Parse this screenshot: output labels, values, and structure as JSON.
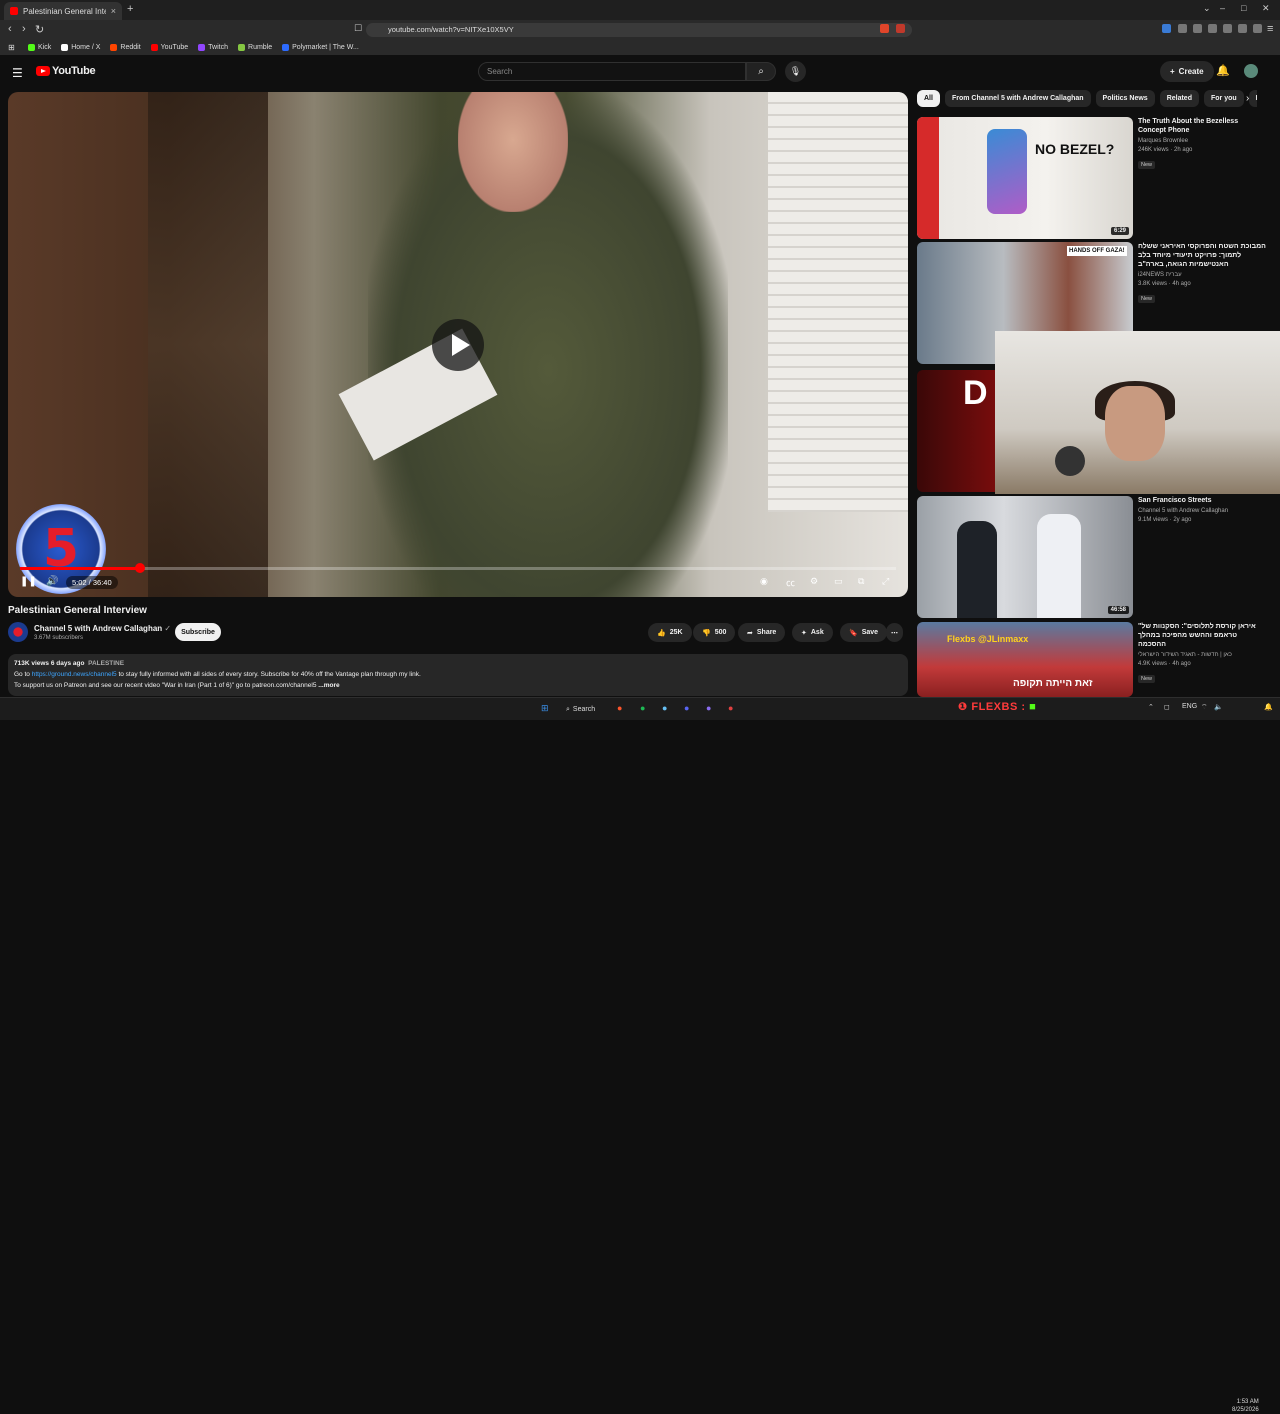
{
  "browser": {
    "tab_title": "Palestinian General Interview",
    "tab_close": "×",
    "new_tab": "+",
    "url": "youtube.com/watch?v=NITXe10X5VY",
    "bookmarks": [
      {
        "label": "Kick",
        "color": "#53fc18"
      },
      {
        "label": "Home / X",
        "color": "#ffffff"
      },
      {
        "label": "Reddit",
        "color": "#ff4500"
      },
      {
        "label": "YouTube",
        "color": "#ff0000"
      },
      {
        "label": "Twitch",
        "color": "#9146ff"
      },
      {
        "label": "Rumble",
        "color": "#85c742"
      },
      {
        "label": "Polymarket | The W...",
        "color": "#2d6bff"
      }
    ]
  },
  "youtube": {
    "logo_text": "YouTube",
    "search_placeholder": "Search",
    "create_label": "Create",
    "accent": "#ff0000"
  },
  "player": {
    "time": "5:02 / 36:40",
    "progress_fraction": 0.137,
    "logo_text": "5"
  },
  "video": {
    "title": "Palestinian General Interview",
    "channel": "Channel 5 with Andrew Callaghan",
    "subscribers": "3.67M subscribers",
    "subscribe_label": "Subscribe",
    "likes": "25K",
    "dislikes": "500",
    "share_label": "Share",
    "ask_label": "Ask",
    "save_label": "Save",
    "views_date": "713K views  6 days ago",
    "tag": "PALESTINE",
    "desc_prefix": "Go to ",
    "desc_link": "https://ground.news/channel5",
    "desc_suffix": " to stay fully informed with all sides of every story. Subscribe for 40% off the Vantage plan through my link.",
    "desc_line2": "To support us on Patreon and see our recent video \"War in Iran (Part 1 of 6)\" go to patreon.com/channel5",
    "more_label": "...more"
  },
  "chips": [
    "All",
    "From Channel 5 with Andrew Callaghan",
    "Politics News",
    "Related",
    "For you",
    "Rece"
  ],
  "recommendations": [
    {
      "title": "The Truth About the Bezelless Concept Phone",
      "channel": "Marques Brownlee",
      "stats": "246K views · 2h ago",
      "badge": "New",
      "duration": "6:29",
      "thumb_text": "NO BEZEL?"
    },
    {
      "title": "המבוכת השטח והפרוקסי האיראני ששלח לתמוך: פרויקט תיעודי מיוחד בלב האנטישמיות הגואה, בארה\"ב",
      "channel": "i24NEWS עברית",
      "stats": "3.8K views · 4h ago",
      "badge": "New",
      "duration": "",
      "thumb_text": "HANDS OFF GAZA!"
    },
    {
      "title": "",
      "channel": "",
      "stats": "",
      "badge": "",
      "duration": "",
      "thumb_text": "D"
    },
    {
      "title": "San Francisco Streets",
      "channel": "Channel 5 with Andrew Callaghan",
      "stats": "9.1M views · 2y ago",
      "badge": "",
      "duration": "46:58",
      "thumb_text": ""
    },
    {
      "title": "\"איראן קורסת לתלוסים\": הסקנוות של טראמפ וההשש מהפיכה במהלך ההסכמה",
      "channel": "כאן | חדשות - תאגיד השידור הישראלי",
      "stats": "4.9K views · 4h ago",
      "badge": "New",
      "duration": "",
      "thumb_text": "זאת הייתה תקופה"
    }
  ],
  "overlay": {
    "flexbs": "FLEXBS",
    "thumb_overlay": "Flexbs @JLinmaxx"
  },
  "taskbar": {
    "search_label": "Search",
    "lang": "ENG",
    "time": "1:53 AM",
    "date": "8/25/2026"
  }
}
